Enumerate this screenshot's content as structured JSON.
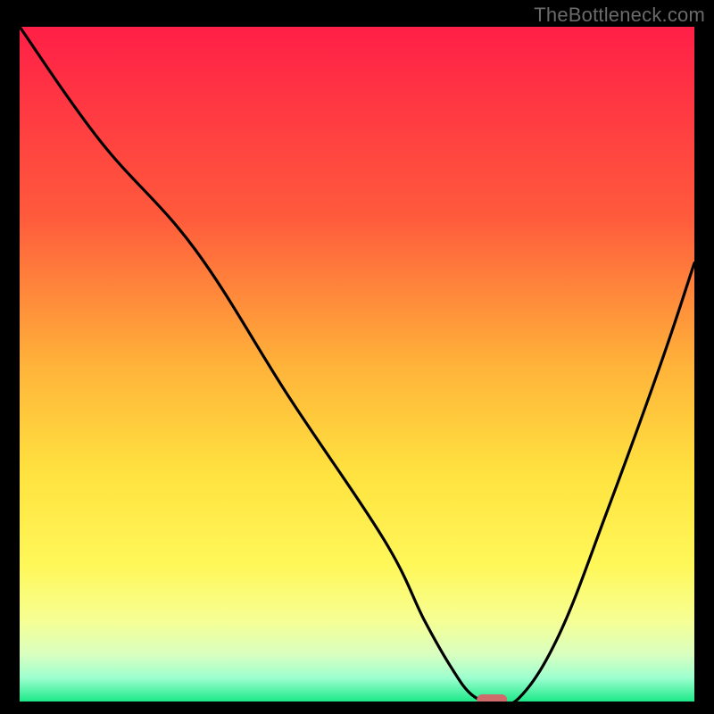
{
  "watermark": "TheBottleneck.com",
  "colors": {
    "frame": "#000000",
    "watermark": "#6a6a6a",
    "curve": "#000000",
    "marker": "#cf6b6b",
    "gradient_stops": [
      {
        "offset": 0.0,
        "color": "#ff1f47"
      },
      {
        "offset": 0.28,
        "color": "#ff5a3c"
      },
      {
        "offset": 0.5,
        "color": "#ffb23a"
      },
      {
        "offset": 0.66,
        "color": "#ffe23f"
      },
      {
        "offset": 0.8,
        "color": "#fff85a"
      },
      {
        "offset": 0.88,
        "color": "#f6ff94"
      },
      {
        "offset": 0.93,
        "color": "#d9ffc0"
      },
      {
        "offset": 0.965,
        "color": "#9dffcf"
      },
      {
        "offset": 1.0,
        "color": "#1de989"
      }
    ]
  },
  "chart_data": {
    "type": "line",
    "title": "",
    "xlabel": "",
    "ylabel": "",
    "xlim": [
      0,
      100
    ],
    "ylim": [
      0,
      100
    ],
    "x": [
      0,
      12,
      26,
      40,
      54,
      60,
      64,
      67,
      70,
      74,
      80,
      87,
      95,
      100
    ],
    "values": [
      100,
      83,
      67,
      45,
      24,
      12,
      5,
      1,
      0,
      0.5,
      10,
      28,
      50,
      65
    ],
    "marker": {
      "x": 70,
      "y": 0
    }
  }
}
